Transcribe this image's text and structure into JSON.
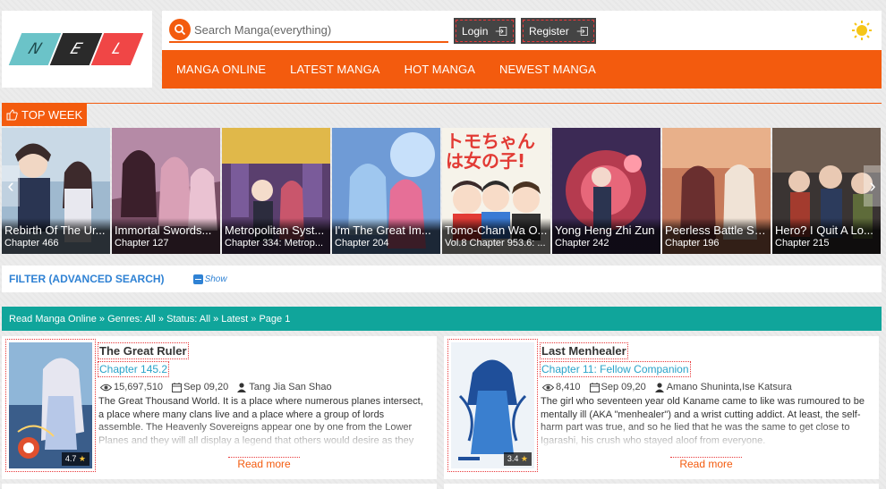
{
  "logo": {
    "letters": [
      "N",
      "E",
      "L"
    ]
  },
  "search": {
    "placeholder": "Search Manga(everything)"
  },
  "header": {
    "login_label": "Login",
    "register_label": "Register"
  },
  "nav": {
    "items": [
      "MANGA ONLINE",
      "LATEST MANGA",
      "HOT MANGA",
      "NEWEST MANGA"
    ]
  },
  "topweek": {
    "label": "TOP WEEK"
  },
  "carousel": {
    "items": [
      {
        "title": "Rebirth Of The Ur...",
        "chapter": "Chapter 466"
      },
      {
        "title": "Immortal Swords...",
        "chapter": "Chapter 127"
      },
      {
        "title": "Metropolitan Syst...",
        "chapter": "Chapter 334: Metrop..."
      },
      {
        "title": "I'm The Great Im...",
        "chapter": "Chapter 204"
      },
      {
        "title": "Tomo-Chan Wa O...",
        "chapter": "Vol.8 Chapter 953.6: ..."
      },
      {
        "title": "Yong Heng Zhi Zun",
        "chapter": "Chapter 242"
      },
      {
        "title": "Peerless Battle Sp...",
        "chapter": "Chapter 196"
      },
      {
        "title": "Hero? I Quit A Lo...",
        "chapter": "Chapter 215"
      }
    ],
    "cover_text": {
      "tomo": "トモちゃんは女の子!"
    }
  },
  "filter": {
    "title": "FILTER (ADVANCED SEARCH)",
    "show_label": "Show"
  },
  "breadcrumb": {
    "text": "Read Manga Online » Genres: All » Status: All » Latest » Page 1"
  },
  "cards": [
    {
      "title": "The Great Ruler",
      "chapter": "Chapter 145.2",
      "views": "15,697,510",
      "date": "Sep 09,20",
      "author": "Tang Jia San Shao",
      "description": "The Great Thousand World. It is a place where numerous planes intersect, a place where many clans live and a place where a group of lords assemble. The Heavenly Sovereigns appear one by one from the Lower Planes and they will all display a legend that others would desire as they pursue the path of the strongest in this world. In the",
      "rating": "4.7",
      "read_more": "Read more"
    },
    {
      "title": "Last Menhealer",
      "chapter": "Chapter 11: Fellow Companion",
      "views": "8,410",
      "date": "Sep 09,20",
      "author": "Amano Shuninta,Ise Katsura",
      "description": "The girl who seventeen year old Kaname came to like was rumoured to be mentally ill (AKA \"menhealer\") and a wrist cutting addict. At least, the self-harm part was true, and so he lied that he was the same to get close to Igarashi, his crush who stayed aloof from everyone.",
      "rating": "3.4",
      "read_more": "Read more"
    }
  ],
  "colors": {
    "accent": "#f35b0e",
    "teal": "#10a59b",
    "link": "#2f82d4",
    "chapter": "#2aa3c9"
  }
}
